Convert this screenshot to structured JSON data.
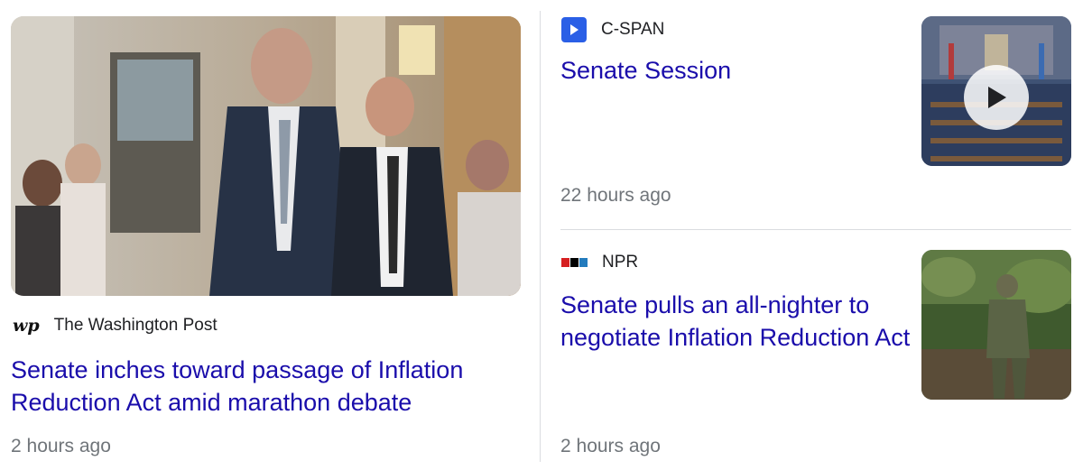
{
  "stories": [
    {
      "source": "The Washington Post",
      "source_icon": "wp-logo-icon",
      "headline": "Senate inches toward passage of Inflation Reduction Act amid marathon debate",
      "time": "2 hours ago"
    },
    {
      "source": "C-SPAN",
      "source_icon": "cspan-play-icon",
      "headline": "Senate Session",
      "time": "22 hours ago",
      "thumbnail_has_video": true
    },
    {
      "source": "NPR",
      "source_icon": "npr-logo-icon",
      "headline": "Senate pulls an all-nighter to negotiate Inflation Reduction Act",
      "time": "2 hours ago"
    }
  ],
  "logos": {
    "wp": "wp",
    "npr": "npr"
  },
  "colors": {
    "headline": "#1a0dab",
    "time": "#70757a",
    "cspan_blue": "#2a5fe6",
    "npr_red": "#d62021",
    "npr_black": "#000000",
    "npr_blue": "#237bbd"
  }
}
